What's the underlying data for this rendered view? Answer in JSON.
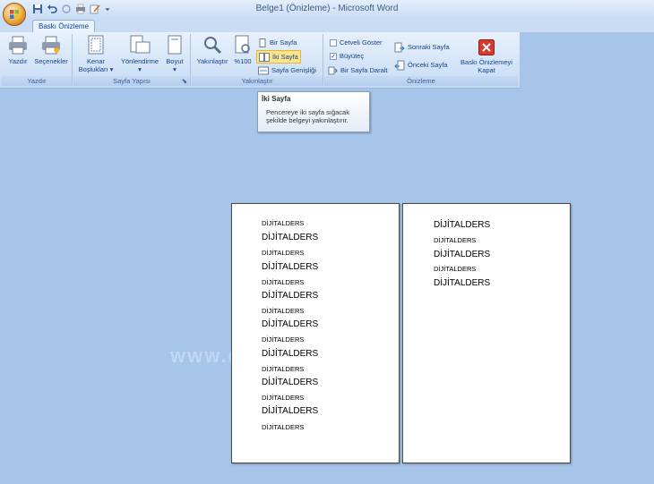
{
  "window": {
    "title": "Belge1 (Önizleme) - Microsoft Word"
  },
  "tabs": [
    {
      "label": "Baskı Önizleme"
    }
  ],
  "ribbon": {
    "groups": {
      "print": {
        "label": "Yazdır",
        "buttons": [
          "Yazdır",
          "Seçenekler"
        ]
      },
      "page_setup": {
        "label": "Sayfa Yapısı",
        "margins": "Kenar Boşlukları",
        "orientation": "Yönlendirme",
        "size": "Boyut"
      },
      "zoom": {
        "label": "Yakınlaştır",
        "zoom": "Yakınlaştır",
        "hundred": "%100",
        "one_page": "Bir Sayfa",
        "two_pages": "İki Sayfa",
        "page_width": "Sayfa Genişliği"
      },
      "preview": {
        "label": "Önizleme",
        "show_ruler": "Cetveli Göster",
        "magnifier": "Büyüteç",
        "shrink_one_page": "Bir Sayfa Daralt",
        "next_page": "Sonraki Sayfa",
        "prev_page": "Önceki Sayfa",
        "close": "Baskı Önizlemeyi Kapat"
      }
    },
    "checks": {
      "show_ruler": false,
      "magnifier": true
    }
  },
  "tooltip": {
    "title": "İki Sayfa",
    "body": "Pencereye iki sayfa sığacak şekilde belgeyi yakınlaştırır."
  },
  "pages": [
    {
      "lines": [
        "DİJİTALDERS",
        "DİJİTALDERS",
        "DİJİTALDERS",
        "DİJİTALDERS",
        "DİJİTALDERS",
        "DİJİTALDERS",
        "DİJİTALDERS",
        "DİJİTALDERS",
        "DİJİTALDERS",
        "DİJİTALDERS",
        "DİJİTALDERS",
        "DİJİTALDERS",
        "DİJİTALDERS",
        "DİJİTALDERS",
        "DİJİTALDERS"
      ]
    },
    {
      "lines": [
        "DİJİTALDERS",
        "DİJİTALDERS",
        "DİJİTALDERS",
        "DİJİTALDERS",
        "DİJİTALDERS"
      ]
    }
  ],
  "watermark": "www.d...ders.com",
  "colors": {
    "background": "#a6c5e8",
    "ribbon_text": "#15428b",
    "close_red": "#d63b2f",
    "active_highlight": "#fde68a"
  }
}
